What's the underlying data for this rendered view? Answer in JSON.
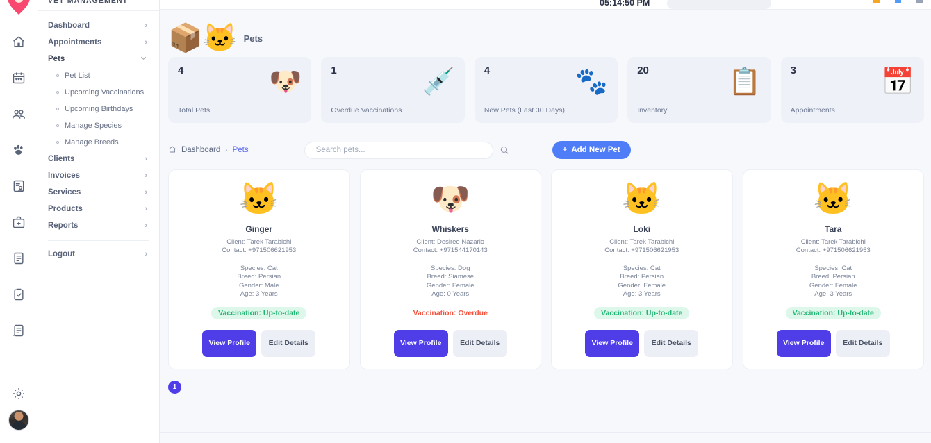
{
  "brand": {
    "title": "VET MANAGEMENT",
    "logo_icon": "heart-paw-logo"
  },
  "rail": {
    "items": [
      {
        "name": "home",
        "icon": "home-icon"
      },
      {
        "name": "calendar",
        "icon": "calendar-icon"
      },
      {
        "name": "clients",
        "icon": "users-icon"
      },
      {
        "name": "pets",
        "icon": "paw-icon"
      },
      {
        "name": "invoices",
        "icon": "invoice-icon"
      },
      {
        "name": "medical",
        "icon": "medical-kit-icon"
      },
      {
        "name": "products",
        "icon": "book-icon"
      },
      {
        "name": "tasks",
        "icon": "clipboard-check-icon"
      },
      {
        "name": "reports",
        "icon": "report-icon"
      }
    ],
    "settings_icon": "gear-icon",
    "avatar": "user-avatar"
  },
  "sidebar": {
    "items": [
      {
        "label": "Dashboard",
        "expandable": true,
        "expanded": false
      },
      {
        "label": "Appointments",
        "expandable": true,
        "expanded": false
      },
      {
        "label": "Pets",
        "expandable": true,
        "expanded": true
      }
    ],
    "pets_children": [
      {
        "label": "Pet List"
      },
      {
        "label": "Upcoming Vaccinations"
      },
      {
        "label": "Upcoming Birthdays"
      },
      {
        "label": "Manage Species"
      },
      {
        "label": "Manage Breeds"
      }
    ],
    "items_after": [
      {
        "label": "Clients"
      },
      {
        "label": "Invoices"
      },
      {
        "label": "Services"
      },
      {
        "label": "Products"
      },
      {
        "label": "Reports"
      }
    ],
    "logout": {
      "label": "Logout"
    },
    "chevron_right": "›",
    "chevron_down": "⌄"
  },
  "topbar": {
    "time": "05:14:50 PM",
    "icons": [
      {
        "name": "notification-icon",
        "color": "#f5a623"
      },
      {
        "name": "message-icon",
        "color": "#4f9cf9"
      },
      {
        "name": "settings-icon",
        "color": "#9aa3b5"
      }
    ]
  },
  "page": {
    "title": "Pets",
    "title_emoji": "🐱"
  },
  "stats": [
    {
      "value": "4",
      "label": "Total Pets",
      "emoji": "🐶"
    },
    {
      "value": "1",
      "label": "Overdue Vaccinations",
      "emoji": "💉"
    },
    {
      "value": "4",
      "label": "New Pets (Last 30 Days)",
      "emoji": "🐾"
    },
    {
      "value": "20",
      "label": "Inventory",
      "emoji": "📋"
    },
    {
      "value": "3",
      "label": "Appointments",
      "emoji": "📅"
    }
  ],
  "breadcrumb": {
    "home_icon": "home-icon",
    "first": "Dashboard",
    "separator": "›",
    "current": "Pets"
  },
  "search": {
    "placeholder": "Search pets...",
    "value": "",
    "icon": "search-icon"
  },
  "add_button": {
    "label": "Add New Pet",
    "plus": "+"
  },
  "pets": [
    {
      "emoji": "🐱",
      "name": "Ginger",
      "client": "Client: Tarek Tarabichi",
      "contact": "Contact: +971506621953",
      "species": "Species: Cat",
      "breed": "Breed: Persian",
      "gender": "Gender: Male",
      "age": "Age: 3 Years",
      "vaccination": "Vaccination: Up-to-date",
      "vaccination_status": "ok",
      "view_label": "View Profile",
      "edit_label": "Edit Details"
    },
    {
      "emoji": "🐶",
      "name": "Whiskers",
      "client": "Client: Desiree Nazario",
      "contact": "Contact: +971544170143",
      "species": "Species: Dog",
      "breed": "Breed: Siamese",
      "gender": "Gender: Female",
      "age": "Age: 0 Years",
      "vaccination": "Vaccination: Overdue",
      "vaccination_status": "bad",
      "view_label": "View Profile",
      "edit_label": "Edit Details"
    },
    {
      "emoji": "🐱",
      "name": "Loki",
      "client": "Client: Tarek Tarabichi",
      "contact": "Contact: +971506621953",
      "species": "Species: Cat",
      "breed": "Breed: Persian",
      "gender": "Gender: Female",
      "age": "Age: 3 Years",
      "vaccination": "Vaccination: Up-to-date",
      "vaccination_status": "ok",
      "view_label": "View Profile",
      "edit_label": "Edit Details"
    },
    {
      "emoji": "🐱",
      "name": "Tara",
      "client": "Client: Tarek Tarabichi",
      "contact": "Contact: +971506621953",
      "species": "Species: Cat",
      "breed": "Breed: Persian",
      "gender": "Gender: Female",
      "age": "Age: 3 Years",
      "vaccination": "Vaccination: Up-to-date",
      "vaccination_status": "ok",
      "view_label": "View Profile",
      "edit_label": "Edit Details"
    }
  ],
  "pagination": {
    "pages": [
      "1"
    ],
    "current": "1"
  },
  "colors": {
    "accent_primary": "#4f3ee8",
    "accent_blue": "#4f7cf7",
    "badge_ok_text": "#22b573",
    "badge_ok_bg": "#ddf7ea",
    "badge_bad_text": "#f4513c",
    "page_bg": "#f7f8fc",
    "stat_bg": "#eef1f7"
  }
}
